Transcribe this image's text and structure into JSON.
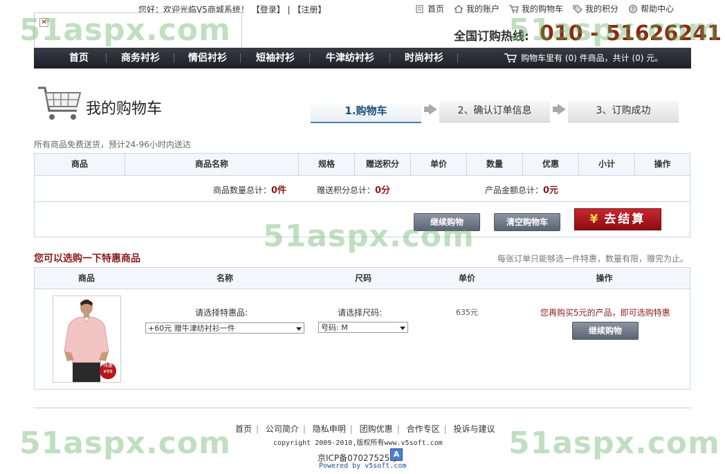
{
  "top": {
    "greeting": "您好：欢迎光临V5商城系统！",
    "login": "【登录】",
    "divider": "|",
    "register": "【注册】",
    "links": [
      {
        "label": "首页",
        "icon": "home-doc-icon"
      },
      {
        "label": "我的账户",
        "icon": "house-icon"
      },
      {
        "label": "我的购物车",
        "icon": "cart-icon"
      },
      {
        "label": "我的积分",
        "icon": "tag-icon"
      },
      {
        "label": "帮助中心",
        "icon": "help-icon"
      }
    ]
  },
  "hotline": {
    "label": "全国订购热线:",
    "number": "010 - 51626241"
  },
  "nav": {
    "items": [
      "首页",
      "商务衬衫",
      "情侣衬衫",
      "短袖衬衫",
      "牛津纺衬衫",
      "时尚衬衫"
    ],
    "cart_summary": "购物车里有 (0) 件商品，共计 (0) 元。"
  },
  "cart": {
    "title": "我的购物车",
    "steps": [
      "1.购物车",
      "2、确认订单信息",
      "3、订购成功"
    ],
    "free_shipping": "所有商品免费送货，预计24-96小时内送达",
    "columns": [
      "商品",
      "商品名称",
      "规格",
      "赠送积分",
      "单价",
      "数量",
      "优惠",
      "小计",
      "操作"
    ],
    "totals": {
      "qty_label": "商品数量总计：",
      "qty_value": "0件",
      "points_label": "赠送积分总计：",
      "points_value": "0分",
      "amount_label": "产品金额总计：",
      "amount_value": "0元"
    },
    "buttons": {
      "continue": "继续购物",
      "clear": "清空购物车",
      "yen": "¥",
      "checkout": "去结算"
    }
  },
  "specials": {
    "title": "您可以选购一下特惠商品",
    "note": "每张订单只能够选一件特惠，数量有限，赠完为止。",
    "columns": [
      "商品",
      "名称",
      "尺码",
      "单价",
      "操作"
    ],
    "row": {
      "name_prompt": "请选择特惠品:",
      "name_selected": "+60元 赠牛津纺衬衫一件",
      "size_prompt": "请选择尺码:",
      "size_selected": "号码: M",
      "price": "635元",
      "message": "您再购买5元的产品，即可选购特惠",
      "button": "继续购物",
      "badge_top": "特惠",
      "badge_price": "¥99"
    }
  },
  "footer": {
    "links": [
      "首页",
      "公司简介",
      "隐私申明",
      "团购优惠",
      "合作专区",
      "投诉与建议"
    ],
    "copyright": "copyright 2009-2010,版权所有www.v5soft.com",
    "icp": "京ICP备07027525号",
    "icp_badge": "A",
    "powered": "Powered by v5soft.com"
  },
  "watermark": "51aspx.com",
  "colors": {
    "accent_red": "#8b1a1a",
    "nav_bg": "#2a2b35",
    "step_active": "#1e4f7b"
  }
}
